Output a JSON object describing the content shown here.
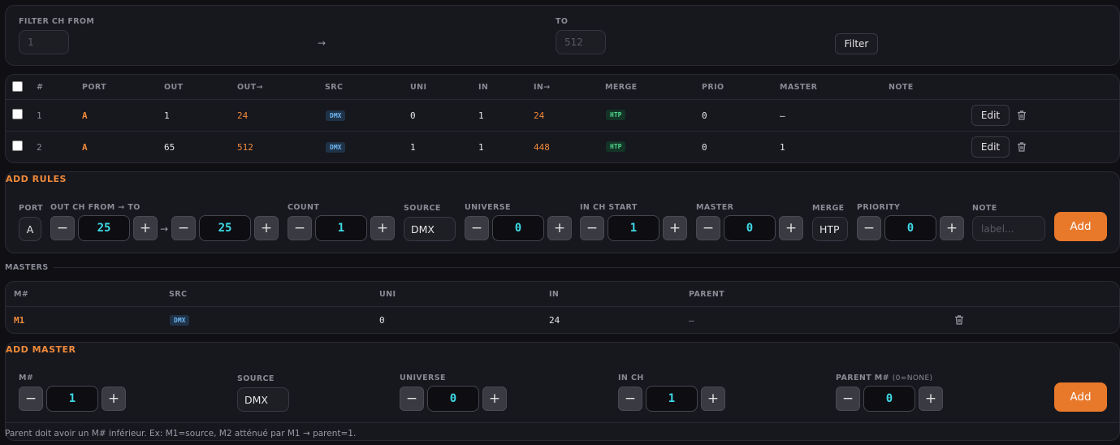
{
  "filter": {
    "from_label": "FILTER CH FROM",
    "from_placeholder": "1",
    "arrow": "→",
    "to_label": "TO",
    "to_placeholder": "512",
    "button": "Filter"
  },
  "rules_table": {
    "headers": [
      "#",
      "PORT",
      "OUT",
      "OUT→",
      "SRC",
      "UNI",
      "IN",
      "IN→",
      "MERGE",
      "PRIO",
      "MASTER",
      "NOTE"
    ],
    "rows": [
      {
        "num": "1",
        "port": "A",
        "out": "1",
        "out_to": "24",
        "src": "DMX",
        "uni": "0",
        "in": "1",
        "in_to": "24",
        "merge": "HTP",
        "prio": "0",
        "master": "–",
        "note": "",
        "edit": "Edit"
      },
      {
        "num": "2",
        "port": "A",
        "out": "65",
        "out_to": "512",
        "src": "DMX",
        "uni": "1",
        "in": "1",
        "in_to": "448",
        "merge": "HTP",
        "prio": "0",
        "master": "1",
        "note": "",
        "edit": "Edit"
      }
    ]
  },
  "add_rules": {
    "title": "ADD RULES",
    "port_label": "PORT",
    "port_value": "A",
    "out_label": "OUT CH FROM → TO",
    "out_from": "25",
    "out_arrow": "→",
    "out_to": "25",
    "count_label": "COUNT",
    "count": "1",
    "source_label": "SOURCE",
    "source": "DMX",
    "universe_label": "UNIVERSE",
    "universe": "0",
    "in_start_label": "IN CH START",
    "in_start": "1",
    "master_label": "MASTER",
    "master": "0",
    "merge_label": "MERGE",
    "merge": "HTP",
    "priority_label": "PRIORITY",
    "priority": "0",
    "note_label": "NOTE",
    "note_placeholder": "label...",
    "add_button": "Add",
    "minus": "−",
    "plus": "+"
  },
  "masters": {
    "section_label": "MASTERS",
    "headers": [
      "M#",
      "SRC",
      "UNI",
      "IN",
      "PARENT"
    ],
    "rows": [
      {
        "m": "M1",
        "src": "DMX",
        "uni": "0",
        "in": "24",
        "parent": "–"
      }
    ]
  },
  "add_master": {
    "title": "ADD MASTER",
    "m_label": "M#",
    "m_value": "1",
    "source_label": "SOURCE",
    "source": "DMX",
    "universe_label": "UNIVERSE",
    "universe": "0",
    "in_ch_label": "IN CH",
    "in_ch": "1",
    "parent_label": "PARENT M#",
    "parent_hint": "(0=NONE)",
    "parent": "0",
    "add_button": "Add",
    "minus": "−",
    "plus": "+",
    "footnote": "Parent doit avoir un M# inférieur. Ex: M1=source, M2 atténué par M1 → parent=1."
  },
  "colors": {
    "accent": "#e8782a",
    "cyan": "#3fd9e6",
    "background": "#0f0f14",
    "panel": "#17171e"
  },
  "icons": {
    "trash": "trash-icon",
    "checkbox": "checkbox"
  }
}
